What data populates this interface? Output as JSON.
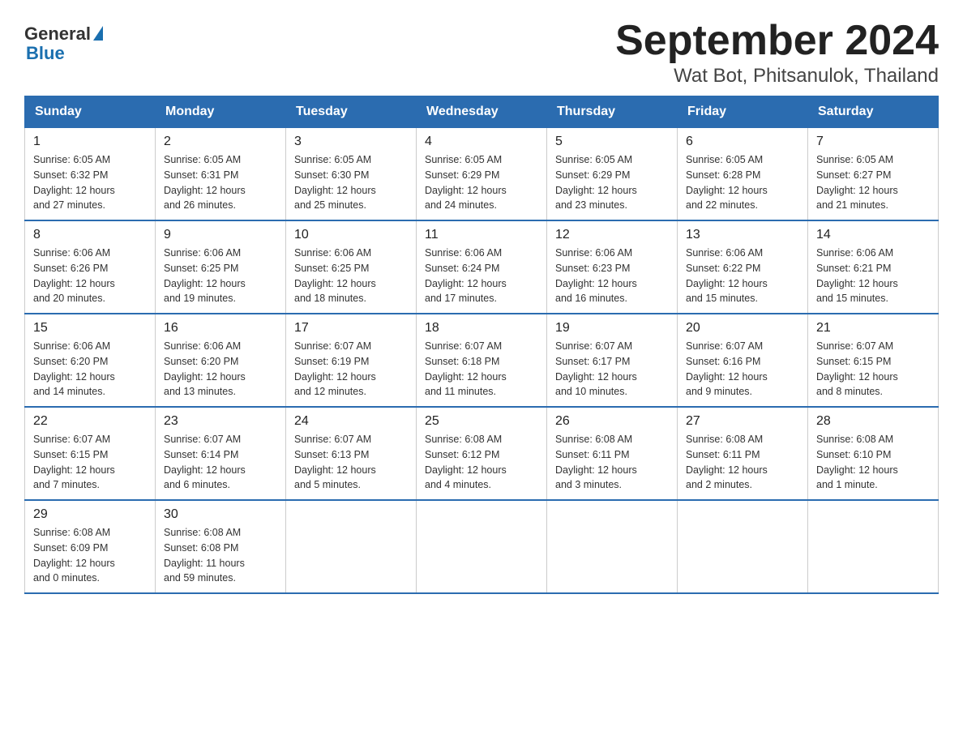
{
  "logo": {
    "general": "General",
    "blue": "Blue"
  },
  "title": "September 2024",
  "subtitle": "Wat Bot, Phitsanulok, Thailand",
  "weekdays": [
    "Sunday",
    "Monday",
    "Tuesday",
    "Wednesday",
    "Thursday",
    "Friday",
    "Saturday"
  ],
  "weeks": [
    [
      {
        "day": "1",
        "sunrise": "6:05 AM",
        "sunset": "6:32 PM",
        "daylight": "12 hours and 27 minutes."
      },
      {
        "day": "2",
        "sunrise": "6:05 AM",
        "sunset": "6:31 PM",
        "daylight": "12 hours and 26 minutes."
      },
      {
        "day": "3",
        "sunrise": "6:05 AM",
        "sunset": "6:30 PM",
        "daylight": "12 hours and 25 minutes."
      },
      {
        "day": "4",
        "sunrise": "6:05 AM",
        "sunset": "6:29 PM",
        "daylight": "12 hours and 24 minutes."
      },
      {
        "day": "5",
        "sunrise": "6:05 AM",
        "sunset": "6:29 PM",
        "daylight": "12 hours and 23 minutes."
      },
      {
        "day": "6",
        "sunrise": "6:05 AM",
        "sunset": "6:28 PM",
        "daylight": "12 hours and 22 minutes."
      },
      {
        "day": "7",
        "sunrise": "6:05 AM",
        "sunset": "6:27 PM",
        "daylight": "12 hours and 21 minutes."
      }
    ],
    [
      {
        "day": "8",
        "sunrise": "6:06 AM",
        "sunset": "6:26 PM",
        "daylight": "12 hours and 20 minutes."
      },
      {
        "day": "9",
        "sunrise": "6:06 AM",
        "sunset": "6:25 PM",
        "daylight": "12 hours and 19 minutes."
      },
      {
        "day": "10",
        "sunrise": "6:06 AM",
        "sunset": "6:25 PM",
        "daylight": "12 hours and 18 minutes."
      },
      {
        "day": "11",
        "sunrise": "6:06 AM",
        "sunset": "6:24 PM",
        "daylight": "12 hours and 17 minutes."
      },
      {
        "day": "12",
        "sunrise": "6:06 AM",
        "sunset": "6:23 PM",
        "daylight": "12 hours and 16 minutes."
      },
      {
        "day": "13",
        "sunrise": "6:06 AM",
        "sunset": "6:22 PM",
        "daylight": "12 hours and 15 minutes."
      },
      {
        "day": "14",
        "sunrise": "6:06 AM",
        "sunset": "6:21 PM",
        "daylight": "12 hours and 15 minutes."
      }
    ],
    [
      {
        "day": "15",
        "sunrise": "6:06 AM",
        "sunset": "6:20 PM",
        "daylight": "12 hours and 14 minutes."
      },
      {
        "day": "16",
        "sunrise": "6:06 AM",
        "sunset": "6:20 PM",
        "daylight": "12 hours and 13 minutes."
      },
      {
        "day": "17",
        "sunrise": "6:07 AM",
        "sunset": "6:19 PM",
        "daylight": "12 hours and 12 minutes."
      },
      {
        "day": "18",
        "sunrise": "6:07 AM",
        "sunset": "6:18 PM",
        "daylight": "12 hours and 11 minutes."
      },
      {
        "day": "19",
        "sunrise": "6:07 AM",
        "sunset": "6:17 PM",
        "daylight": "12 hours and 10 minutes."
      },
      {
        "day": "20",
        "sunrise": "6:07 AM",
        "sunset": "6:16 PM",
        "daylight": "12 hours and 9 minutes."
      },
      {
        "day": "21",
        "sunrise": "6:07 AM",
        "sunset": "6:15 PM",
        "daylight": "12 hours and 8 minutes."
      }
    ],
    [
      {
        "day": "22",
        "sunrise": "6:07 AM",
        "sunset": "6:15 PM",
        "daylight": "12 hours and 7 minutes."
      },
      {
        "day": "23",
        "sunrise": "6:07 AM",
        "sunset": "6:14 PM",
        "daylight": "12 hours and 6 minutes."
      },
      {
        "day": "24",
        "sunrise": "6:07 AM",
        "sunset": "6:13 PM",
        "daylight": "12 hours and 5 minutes."
      },
      {
        "day": "25",
        "sunrise": "6:08 AM",
        "sunset": "6:12 PM",
        "daylight": "12 hours and 4 minutes."
      },
      {
        "day": "26",
        "sunrise": "6:08 AM",
        "sunset": "6:11 PM",
        "daylight": "12 hours and 3 minutes."
      },
      {
        "day": "27",
        "sunrise": "6:08 AM",
        "sunset": "6:11 PM",
        "daylight": "12 hours and 2 minutes."
      },
      {
        "day": "28",
        "sunrise": "6:08 AM",
        "sunset": "6:10 PM",
        "daylight": "12 hours and 1 minute."
      }
    ],
    [
      {
        "day": "29",
        "sunrise": "6:08 AM",
        "sunset": "6:09 PM",
        "daylight": "12 hours and 0 minutes."
      },
      {
        "day": "30",
        "sunrise": "6:08 AM",
        "sunset": "6:08 PM",
        "daylight": "11 hours and 59 minutes."
      },
      null,
      null,
      null,
      null,
      null
    ]
  ],
  "labels": {
    "sunrise": "Sunrise:",
    "sunset": "Sunset:",
    "daylight": "Daylight:"
  }
}
